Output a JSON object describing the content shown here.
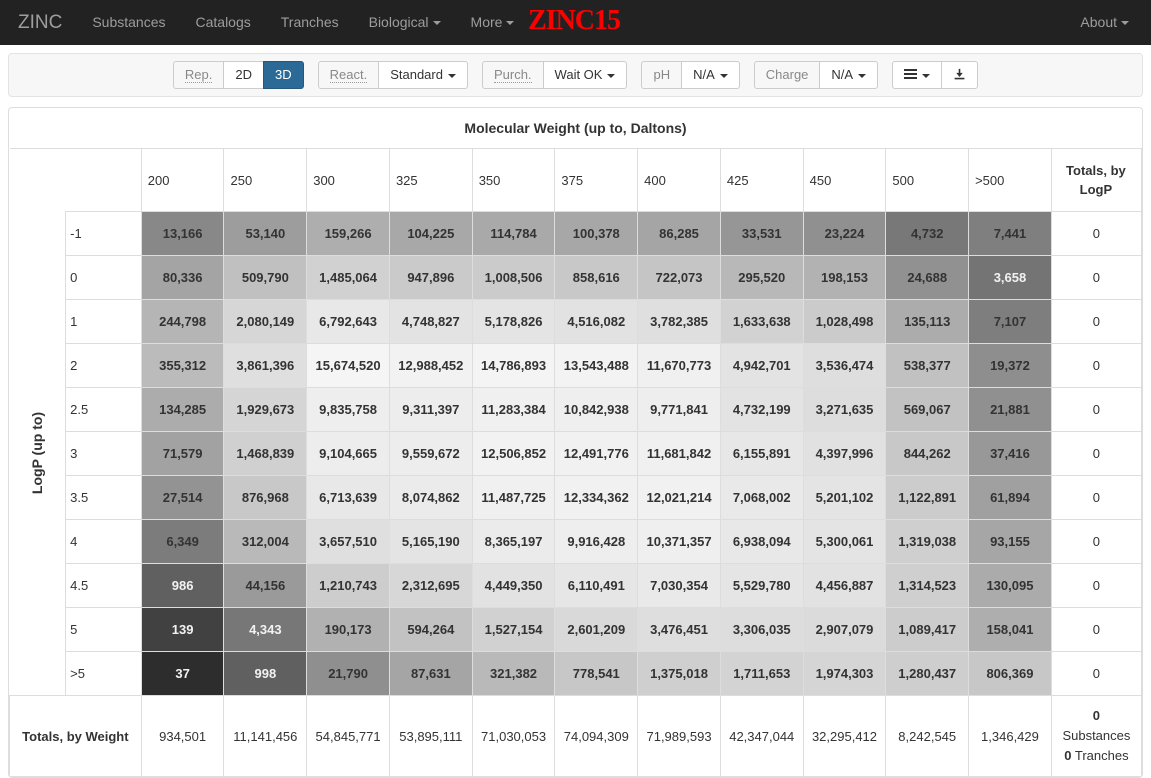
{
  "navbar": {
    "brand": "ZINC",
    "links": [
      {
        "label": "Substances",
        "caret": false
      },
      {
        "label": "Catalogs",
        "caret": false
      },
      {
        "label": "Tranches",
        "caret": false
      },
      {
        "label": "Biological",
        "caret": true
      },
      {
        "label": "More",
        "caret": true
      }
    ],
    "logo": "ZINC15",
    "right_label": "About"
  },
  "toolbar": {
    "rep_label": "Rep.",
    "rep_2d": "2D",
    "rep_3d": "3D",
    "react_label": "React.",
    "react_value": "Standard",
    "purch_label": "Purch.",
    "purch_value": "Wait OK",
    "ph_label": "pH",
    "ph_value": "N/A",
    "charge_label": "Charge",
    "charge_value": "N/A",
    "grid_icon": "grid-icon",
    "download_icon": "download-icon"
  },
  "table": {
    "supertitle": "Molecular Weight (up to, Daltons)",
    "yaxis_label": "LogP (up to)",
    "row_total_header": "Totals, by LogP",
    "col_total_label": "Totals, by Weight",
    "grand_total_value": "0",
    "grand_total_substances": "Substances",
    "grand_total_tranches_count": "0",
    "grand_total_tranches": "Tranches"
  },
  "chart_data": {
    "type": "heatmap",
    "title": "Molecular Weight (up to, Daltons)",
    "xlabel": "Molecular Weight (up to, Daltons)",
    "ylabel": "LogP (up to)",
    "categories": [
      "200",
      "250",
      "300",
      "325",
      "350",
      "375",
      "400",
      "425",
      "450",
      "500",
      ">500"
    ],
    "rows": [
      "-1",
      "0",
      "1",
      "2",
      "2.5",
      "3",
      "3.5",
      "4",
      "4.5",
      "5",
      ">5"
    ],
    "values": [
      [
        13166,
        53140,
        159266,
        104225,
        114784,
        100378,
        86285,
        33531,
        23224,
        4732,
        7441
      ],
      [
        80336,
        509790,
        1485064,
        947896,
        1008506,
        858616,
        722073,
        295520,
        198153,
        24688,
        3658
      ],
      [
        244798,
        2080149,
        6792643,
        4748827,
        5178826,
        4516082,
        3782385,
        1633638,
        1028498,
        135113,
        7107
      ],
      [
        355312,
        3861396,
        15674520,
        12988452,
        14786893,
        13543488,
        11670773,
        4942701,
        3536474,
        538377,
        19372
      ],
      [
        134285,
        1929673,
        9835758,
        9311397,
        11283384,
        10842938,
        9771841,
        4732199,
        3271635,
        569067,
        21881
      ],
      [
        71579,
        1468839,
        9104665,
        9559672,
        12506852,
        12491776,
        11681842,
        6155891,
        4397996,
        844262,
        37416
      ],
      [
        27514,
        876968,
        6713639,
        8074862,
        11487725,
        12334362,
        12021214,
        7068002,
        5201102,
        1122891,
        61894
      ],
      [
        6349,
        312004,
        3657510,
        5165190,
        8365197,
        9916428,
        10371357,
        6938094,
        5300061,
        1319038,
        93155
      ],
      [
        986,
        44156,
        1210743,
        2312695,
        4449350,
        6110491,
        7030354,
        5529780,
        4456887,
        1314523,
        130095
      ],
      [
        139,
        4343,
        190173,
        594264,
        1527154,
        2601209,
        3476451,
        3306035,
        2907079,
        1089417,
        158041
      ],
      [
        37,
        998,
        21790,
        87631,
        321382,
        778541,
        1375018,
        1711653,
        1974303,
        1280437,
        806369
      ]
    ],
    "values_formatted": [
      [
        "13,166",
        "53,140",
        "159,266",
        "104,225",
        "114,784",
        "100,378",
        "86,285",
        "33,531",
        "23,224",
        "4,732",
        "7,441"
      ],
      [
        "80,336",
        "509,790",
        "1,485,064",
        "947,896",
        "1,008,506",
        "858,616",
        "722,073",
        "295,520",
        "198,153",
        "24,688",
        "3,658"
      ],
      [
        "244,798",
        "2,080,149",
        "6,792,643",
        "4,748,827",
        "5,178,826",
        "4,516,082",
        "3,782,385",
        "1,633,638",
        "1,028,498",
        "135,113",
        "7,107"
      ],
      [
        "355,312",
        "3,861,396",
        "15,674,520",
        "12,988,452",
        "14,786,893",
        "13,543,488",
        "11,670,773",
        "4,942,701",
        "3,536,474",
        "538,377",
        "19,372"
      ],
      [
        "134,285",
        "1,929,673",
        "9,835,758",
        "9,311,397",
        "11,283,384",
        "10,842,938",
        "9,771,841",
        "4,732,199",
        "3,271,635",
        "569,067",
        "21,881"
      ],
      [
        "71,579",
        "1,468,839",
        "9,104,665",
        "9,559,672",
        "12,506,852",
        "12,491,776",
        "11,681,842",
        "6,155,891",
        "4,397,996",
        "844,262",
        "37,416"
      ],
      [
        "27,514",
        "876,968",
        "6,713,639",
        "8,074,862",
        "11,487,725",
        "12,334,362",
        "12,021,214",
        "7,068,002",
        "5,201,102",
        "1,122,891",
        "61,894"
      ],
      [
        "6,349",
        "312,004",
        "3,657,510",
        "5,165,190",
        "8,365,197",
        "9,916,428",
        "10,371,357",
        "6,938,094",
        "5,300,061",
        "1,319,038",
        "93,155"
      ],
      [
        "986",
        "44,156",
        "1,210,743",
        "2,312,695",
        "4,449,350",
        "6,110,491",
        "7,030,354",
        "5,529,780",
        "4,456,887",
        "1,314,523",
        "130,095"
      ],
      [
        "139",
        "4,343",
        "190,173",
        "594,264",
        "1,527,154",
        "2,601,209",
        "3,476,451",
        "3,306,035",
        "2,907,079",
        "1,089,417",
        "158,041"
      ],
      [
        "37",
        "998",
        "21,790",
        "87,631",
        "321,382",
        "778,541",
        "1,375,018",
        "1,711,653",
        "1,974,303",
        "1,280,437",
        "806,369"
      ]
    ],
    "row_totals": [
      "0",
      "0",
      "0",
      "0",
      "0",
      "0",
      "0",
      "0",
      "0",
      "0",
      "0"
    ],
    "column_totals": [
      "934,501",
      "11,141,456",
      "54,845,771",
      "53,895,111",
      "71,030,053",
      "74,094,309",
      "71,989,593",
      "42,347,044",
      "32,295,412",
      "8,242,545",
      "1,346,429"
    ],
    "colormap": "grayscale-log",
    "legend": "none",
    "grid": true
  }
}
